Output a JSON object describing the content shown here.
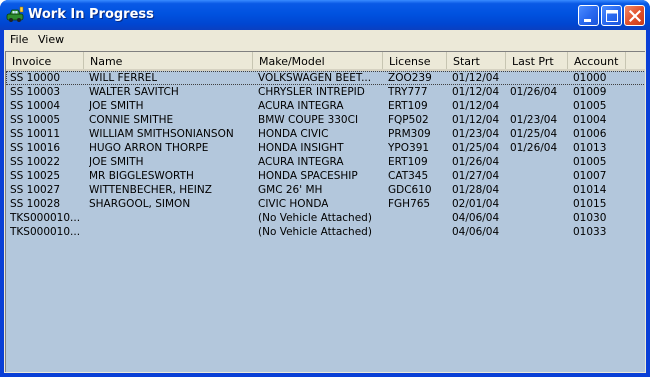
{
  "window": {
    "title": "Work In Progress",
    "icon": "car-app-icon"
  },
  "menu": [
    "File",
    "View"
  ],
  "columns": [
    "Invoice",
    "Name",
    "Make/Model",
    "License",
    "Start",
    "Last Prt",
    "Account"
  ],
  "rows": [
    {
      "invoice": "SS    10000",
      "name": "WILL FERREL",
      "make_model": "VOLKSWAGEN BEET...",
      "license": "ZOO239",
      "start": "01/12/04",
      "last_prt": "",
      "account": "01000"
    },
    {
      "invoice": "SS    10003",
      "name": "WALTER SAVITCH",
      "make_model": "CHRYSLER INTREPID",
      "license": "TRY777",
      "start": "01/12/04",
      "last_prt": "01/26/04",
      "account": "01009"
    },
    {
      "invoice": "SS    10004",
      "name": "JOE SMITH",
      "make_model": "ACURA INTEGRA",
      "license": "ERT109",
      "start": "01/12/04",
      "last_prt": "",
      "account": "01005"
    },
    {
      "invoice": "SS    10005",
      "name": "CONNIE SMITHE",
      "make_model": "BMW COUPE 330CI",
      "license": "FQP502",
      "start": "01/12/04",
      "last_prt": "01/23/04",
      "account": "01004"
    },
    {
      "invoice": "SS    10011",
      "name": "WILLIAM SMITHSONIANSON",
      "make_model": "HONDA CIVIC",
      "license": "PRM309",
      "start": "01/23/04",
      "last_prt": "01/25/04",
      "account": "01006"
    },
    {
      "invoice": "SS    10016",
      "name": "HUGO ARRON THORPE",
      "make_model": "HONDA INSIGHT",
      "license": "YPO391",
      "start": "01/25/04",
      "last_prt": "01/26/04",
      "account": "01013"
    },
    {
      "invoice": "SS    10022",
      "name": "JOE SMITH",
      "make_model": "ACURA INTEGRA",
      "license": "ERT109",
      "start": "01/26/04",
      "last_prt": "",
      "account": "01005"
    },
    {
      "invoice": "SS    10025",
      "name": "MR BIGGLESWORTH",
      "make_model": "HONDA SPACESHIP",
      "license": "CAT345",
      "start": "01/27/04",
      "last_prt": "",
      "account": "01007"
    },
    {
      "invoice": "SS    10027",
      "name": "WITTENBECHER, HEINZ",
      "make_model": "GMC 26' MH",
      "license": "GDC610",
      "start": "01/28/04",
      "last_prt": "",
      "account": "01014"
    },
    {
      "invoice": "SS    10028",
      "name": "SHARGOOL, SIMON",
      "make_model": "CIVIC HONDA",
      "license": "FGH765",
      "start": "02/01/04",
      "last_prt": "",
      "account": "01015"
    },
    {
      "invoice": "TKS000010...",
      "name": "",
      "make_model": "(No Vehicle Attached)",
      "license": "",
      "start": "04/06/04",
      "last_prt": "",
      "account": "01030"
    },
    {
      "invoice": "TKS000010...",
      "name": "",
      "make_model": "(No Vehicle Attached)",
      "license": "",
      "start": "04/06/04",
      "last_prt": "",
      "account": "01033"
    }
  ],
  "colors": {
    "list_background": "#b3c7dc",
    "titlebar": "#0052e0",
    "close_button": "#e2522d"
  }
}
